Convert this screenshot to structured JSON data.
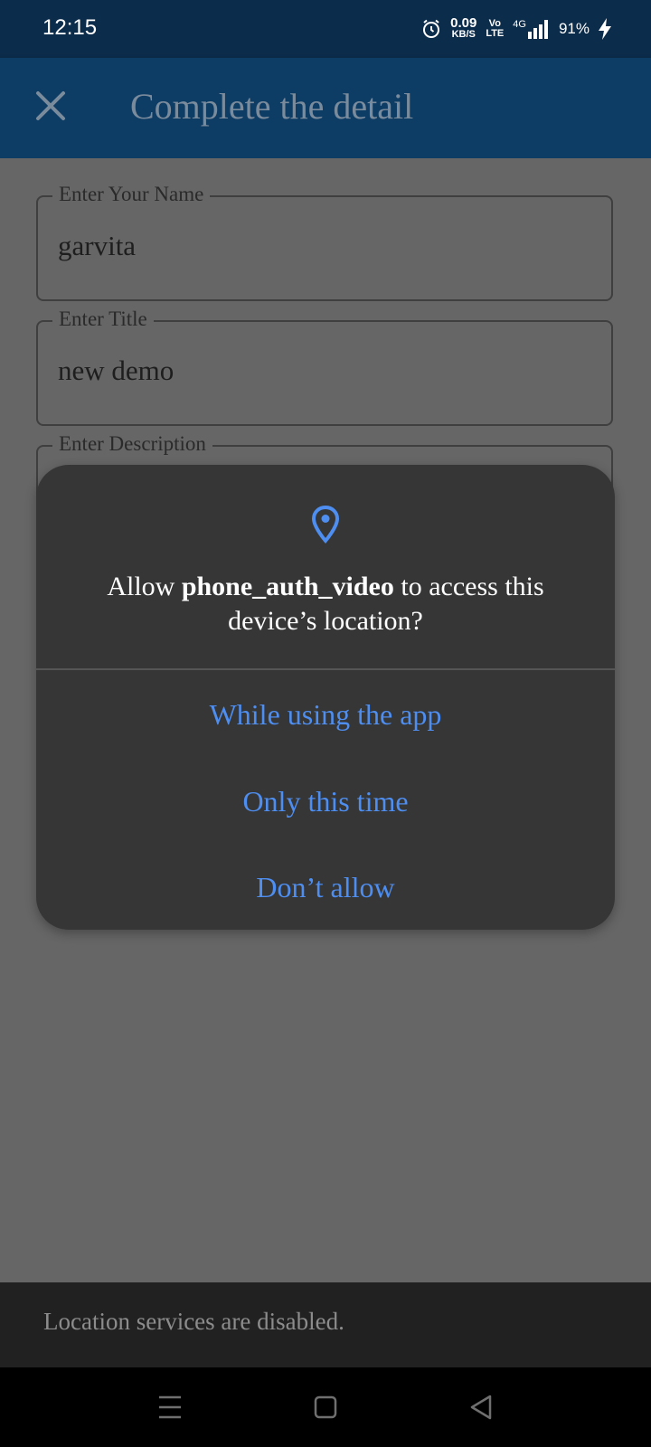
{
  "status_bar": {
    "time": "12:15",
    "net_speed_value": "0.09",
    "net_speed_unit": "KB/S",
    "volte_top": "Vo",
    "volte_bottom": "LTE",
    "network_type": "4G",
    "battery": "91%",
    "icons": [
      "alarm-icon",
      "signal-icon",
      "charging-icon"
    ]
  },
  "app_bar": {
    "title": "Complete the detail",
    "close_icon": "close-icon"
  },
  "form": {
    "name": {
      "label": "Enter Your Name",
      "value": "garvita"
    },
    "title": {
      "label": "Enter Title",
      "value": "new demo"
    },
    "description": {
      "label": "Enter Description",
      "value": ""
    }
  },
  "permission_dialog": {
    "icon": "location-pin-icon",
    "message_prefix": "Allow ",
    "app_name": "phone_auth_video",
    "message_suffix": " to access this device’s location?",
    "buttons": {
      "while_using": "While using the app",
      "only_this_time": "Only this time",
      "dont_allow": "Don’t allow"
    }
  },
  "snackbar": {
    "text": "Location services are disabled."
  },
  "nav_bar": {
    "icons": [
      "menu-icon",
      "home-icon",
      "back-icon"
    ]
  },
  "colors": {
    "status_bar": "#0c2c4b",
    "app_bar": "#0d3c65",
    "scrim_background": "#666666",
    "dialog_background": "#363636",
    "dialog_accent": "#4e8ef0",
    "snackbar": "#212121"
  }
}
